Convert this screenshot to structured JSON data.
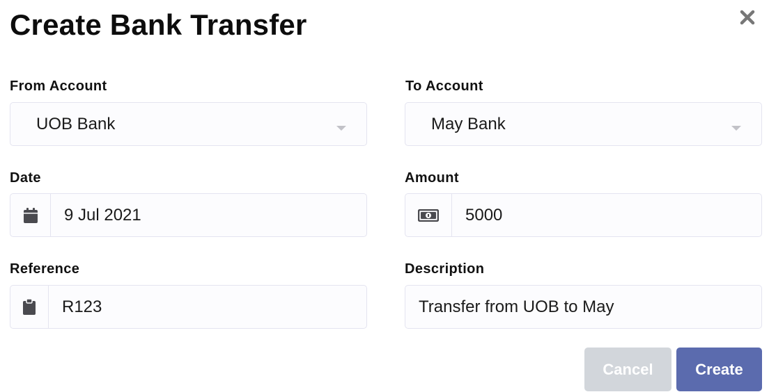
{
  "dialog": {
    "title": "Create Bank Transfer",
    "close_icon": "close-icon"
  },
  "form": {
    "from_account": {
      "label": "From Account",
      "value": "UOB Bank"
    },
    "to_account": {
      "label": "To Account",
      "value": "May Bank"
    },
    "date": {
      "label": "Date",
      "value": "9 Jul 2021",
      "icon": "calendar-icon"
    },
    "amount": {
      "label": "Amount",
      "value": "5000",
      "icon": "money-icon"
    },
    "reference": {
      "label": "Reference",
      "value": "R123",
      "icon": "clipboard-icon"
    },
    "description": {
      "label": "Description",
      "value": "Transfer from UOB to May"
    }
  },
  "actions": {
    "cancel_label": "Cancel",
    "create_label": "Create"
  },
  "colors": {
    "primary": "#5b6bae",
    "cancel": "#d2d6db",
    "field_border": "#e4e4f0"
  }
}
